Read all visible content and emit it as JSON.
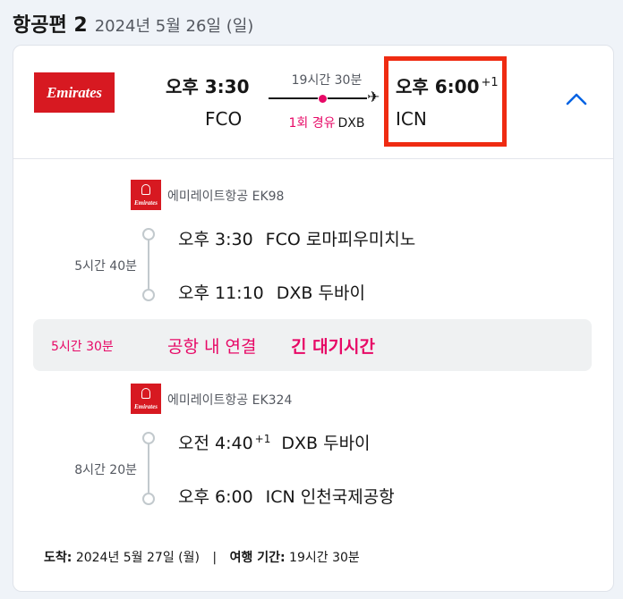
{
  "header": {
    "label": "항공편 2",
    "date": "2024년 5월 26일 (일)"
  },
  "summary": {
    "airline_logo": "Emirates",
    "departure_time": "오후 3:30",
    "departure_code": "FCO",
    "duration": "19시간 30분",
    "stops_count": "1회 경유",
    "stops_via": "DXB",
    "arrival_time": "오후 6:00",
    "arrival_day_offset": "+1",
    "arrival_code": "ICN",
    "collapse_icon": "chevron-up-icon",
    "highlight_color": "#ef2b12"
  },
  "segments": [
    {
      "airline": "에미레이트항공 EK98",
      "logo_text": "Emirates",
      "duration": "5시간 40분",
      "dep_time": "오후 3:30",
      "dep_day_offset": "",
      "dep_place": "FCO 로마피우미치노",
      "arr_time": "오후 11:10",
      "arr_day_offset": "",
      "arr_place": "DXB 두바이"
    },
    {
      "airline": "에미레이트항공 EK324",
      "logo_text": "Emirates",
      "duration": "8시간 20분",
      "dep_time": "오전 4:40",
      "dep_day_offset": "+1",
      "dep_place": "DXB 두바이",
      "arr_time": "오후 6:00",
      "arr_day_offset": "",
      "arr_place": "ICN 인천국제공항"
    }
  ],
  "layover": {
    "duration": "5시간 30분",
    "connection": "공항 내 연결",
    "warning": "긴 대기시간"
  },
  "footer": {
    "arrival_label": "도착:",
    "arrival_value": "2024년 5월 27일 (월)",
    "separator": "|",
    "travel_label": "여행 기간:",
    "travel_value": "19시간 30분"
  },
  "colors": {
    "accent": "#0062e3",
    "warning": "#e70866",
    "brand": "#d71921"
  }
}
